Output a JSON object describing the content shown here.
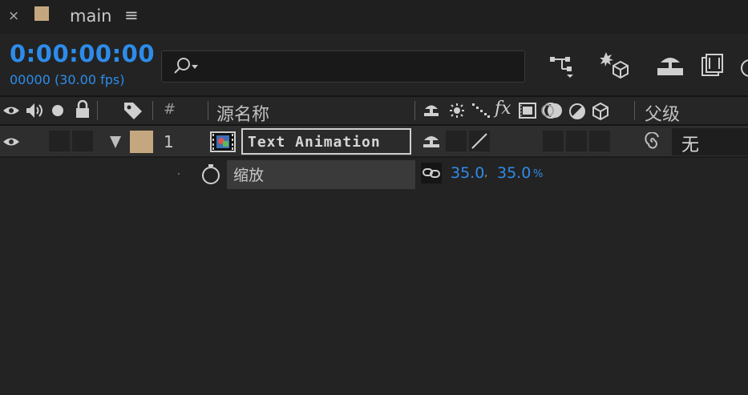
{
  "tab": {
    "close_glyph": "×",
    "title": "main",
    "menu_glyph": "≡",
    "swatch_color": "#c5a77f"
  },
  "toolbar": {
    "timecode": "0:00:00:00",
    "fps": "00000 (30.00 fps)",
    "search_placeholder": "",
    "tools": [
      "comp-flowchart-icon",
      "draft-3d-icon",
      "hide-shy-layers-icon",
      "frame-blending-icon"
    ]
  },
  "columns": {
    "hash": "#",
    "source_name": "源名称",
    "fx": "fx",
    "parent": "父级"
  },
  "layer": {
    "number": "1",
    "name": "Text Animation",
    "label_color": "#c5a77f",
    "parent_value": "无"
  },
  "property": {
    "name": "缩放",
    "value_x": "35.0",
    "value_y": "35.0",
    "unit": "%",
    "sep": ","
  }
}
